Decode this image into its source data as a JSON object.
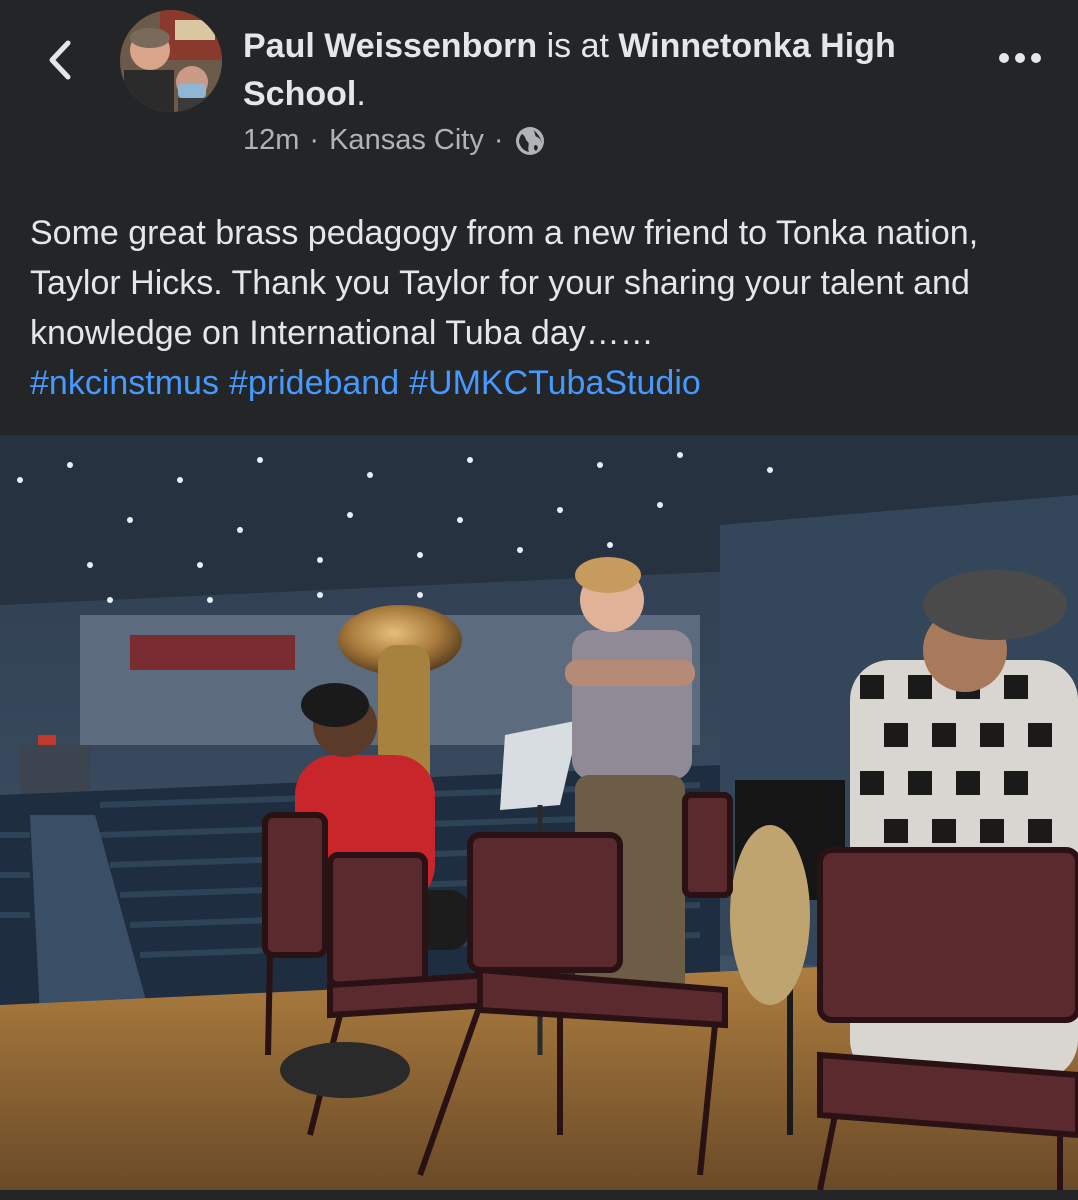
{
  "header": {
    "author": "Paul Weissenborn",
    "connector": " is at ",
    "place": "Winnetonka High School",
    "trailing": ".",
    "time": "12m",
    "separator": "·",
    "location": "Kansas City",
    "separator2": "·"
  },
  "post": {
    "text": "Some great brass pedagogy from a new friend to Tonka nation, Taylor Hicks.   Thank you Taylor for your sharing your talent and knowledge on International Tuba day……",
    "hashtags": [
      "#nkcinstmus",
      "#prideband",
      "#UMKCTubaStudio"
    ]
  },
  "icons": {
    "back": "chevron-left-icon",
    "more": "more-horizontal-icon",
    "audience": "globe-icon"
  },
  "colors": {
    "background": "#242526",
    "text": "#e4e6eb",
    "muted": "#b0b3b8",
    "link": "#4599ff"
  }
}
